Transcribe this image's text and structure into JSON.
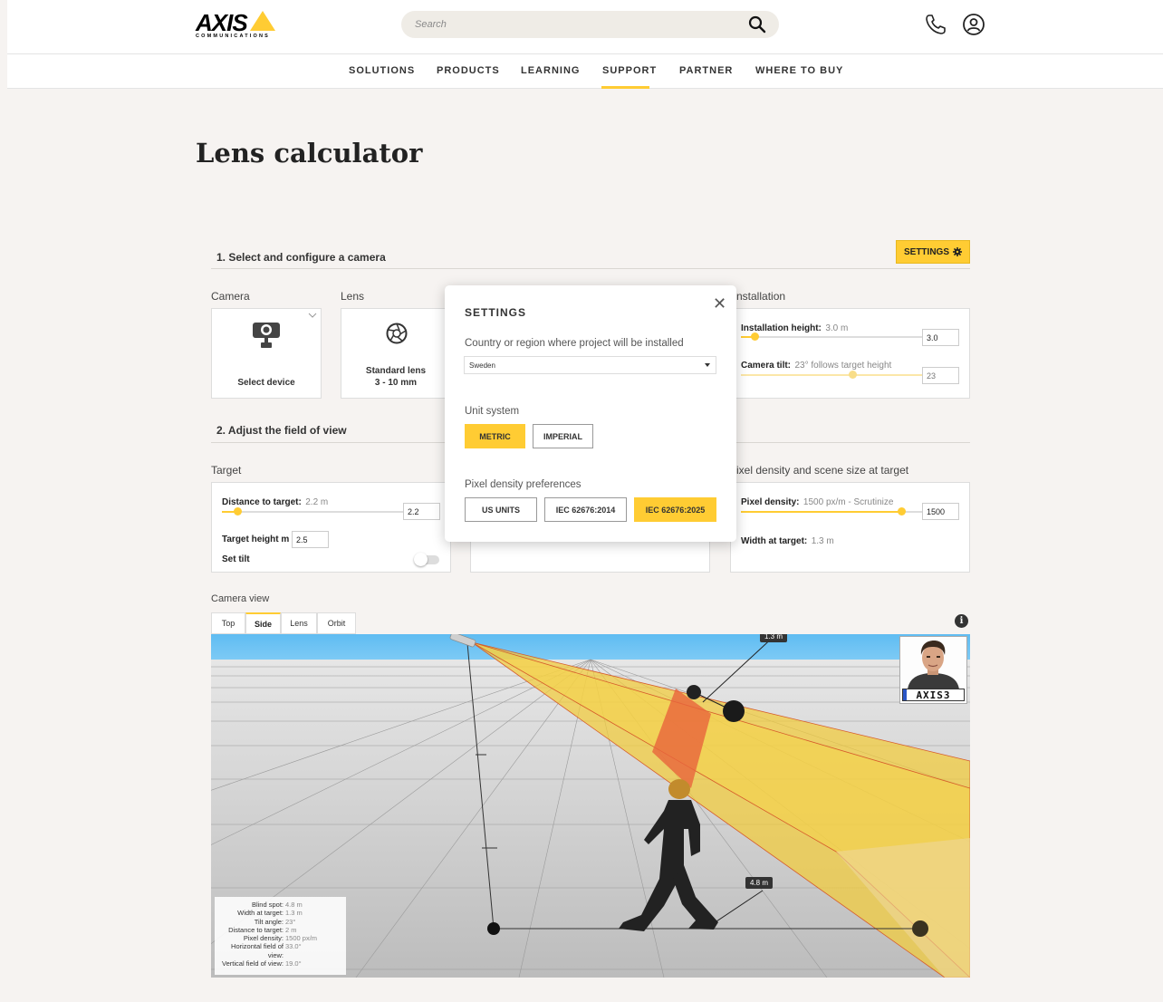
{
  "header": {
    "logo_word": "AXIS",
    "logo_sub": "COMMUNICATIONS",
    "search_placeholder": "Search",
    "nav": [
      "SOLUTIONS",
      "PRODUCTS",
      "LEARNING",
      "SUPPORT",
      "PARTNER",
      "WHERE TO BUY"
    ],
    "active_nav": "SUPPORT"
  },
  "page_title": "Lens calculator",
  "section1": {
    "title": "1. Select and configure a camera",
    "settings_label": "SETTINGS",
    "camera_label": "Camera",
    "camera_card": "Select device",
    "lens_label": "Lens",
    "lens_card_line1": "Standard lens",
    "lens_card_line2": "3 - 10 mm",
    "installation_label": "nstallation",
    "installation_height_label": "Installation height:",
    "installation_height_value": "3.0 m",
    "installation_height_input": "3.0",
    "camera_tilt_label": "Camera tilt:",
    "camera_tilt_value": "23° follows target height",
    "camera_tilt_input": "23"
  },
  "section2": {
    "title": "2. Adjust the field of view",
    "target_label": "Target",
    "distance_label": "Distance to target:",
    "distance_value": "2.2 m",
    "distance_input": "2.2",
    "target_height_label": "Target height m",
    "target_height_input": "2.5",
    "set_tilt_label": "Set tilt",
    "pixel_section_label": "ixel density and scene size at target",
    "pixel_density_label": "Pixel density:",
    "pixel_density_value": "1500 px/m - Scrutinize",
    "pixel_density_input": "1500",
    "width_at_target_label": "Width at target:",
    "width_at_target_value": "1.3 m"
  },
  "camera_view": {
    "label": "Camera view",
    "tabs": [
      "Top",
      "Side",
      "Lens",
      "Orbit"
    ],
    "active_tab": "Side",
    "dim_top": "1.3 m",
    "dim_bottom": "4.8 m",
    "plate_text": "AXIS3",
    "stats": [
      {
        "k": "Blind spot:",
        "v": "4.8 m"
      },
      {
        "k": "Width at target:",
        "v": "1.3 m"
      },
      {
        "k": "Tilt angle:",
        "v": "23°"
      },
      {
        "k": "Distance to target:",
        "v": "2 m"
      },
      {
        "k": "Pixel density:",
        "v": "1500 px/m"
      },
      {
        "k": "Horizontal field of view:",
        "v": "33.0°"
      },
      {
        "k": "Vertical field of view:",
        "v": "19.0°"
      }
    ]
  },
  "modal": {
    "title": "SETTINGS",
    "country_label": "Country or region where project will be installed",
    "country_value": "Sweden",
    "unit_label": "Unit system",
    "unit_options": [
      "METRIC",
      "IMPERIAL"
    ],
    "unit_selected": "METRIC",
    "density_label": "Pixel density preferences",
    "density_options": [
      "US UNITS",
      "IEC 62676:2014",
      "IEC 62676:2025"
    ],
    "density_selected": "IEC 62676:2025"
  },
  "colors": {
    "accent": "#ffcc33",
    "sky": "#5fbcf2",
    "floor": "#c9c9c9"
  }
}
